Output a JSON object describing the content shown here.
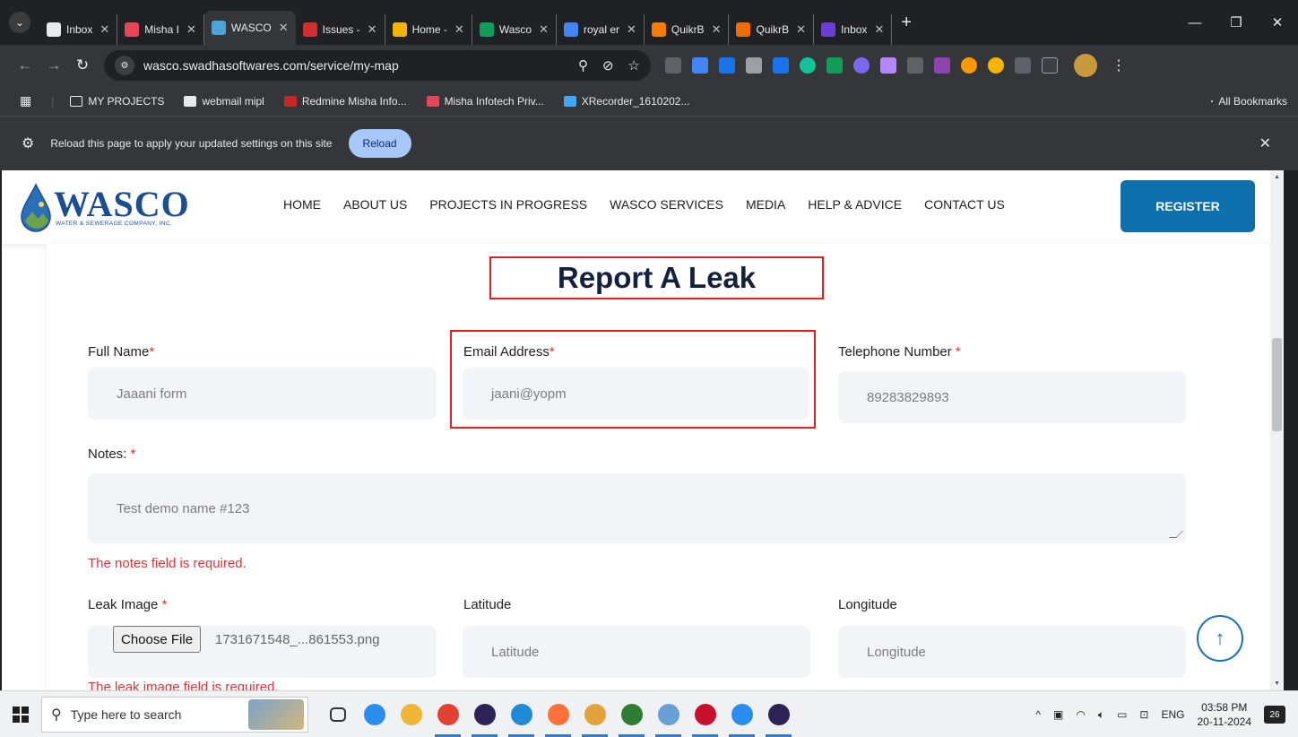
{
  "browser": {
    "tabs": [
      {
        "title": "Inbox",
        "color": "#e8eaed"
      },
      {
        "title": "Misha I",
        "color": "#e8455a"
      },
      {
        "title": "WASCO",
        "color": "#4ea3d8",
        "active": true
      },
      {
        "title": "Issues -",
        "color": "#d32f2f"
      },
      {
        "title": "Home -",
        "color": "#f4b400"
      },
      {
        "title": "Wasco",
        "color": "#0f9d58"
      },
      {
        "title": "royal er",
        "color": "#4285f4"
      },
      {
        "title": "QuikrB",
        "color": "#f57c00"
      },
      {
        "title": "QuikrB",
        "color": "#ef6c00"
      },
      {
        "title": "Inbox",
        "color": "#6a3fd4"
      }
    ],
    "new_tab": "+",
    "url": "wasco.swadhasoftwares.com/service/my-map",
    "bookmarks": [
      {
        "label": "MY PROJECTS",
        "icon": "folder-icon"
      },
      {
        "label": "webmail mipl",
        "icon": "mail-icon"
      },
      {
        "label": "Redmine Misha Info...",
        "icon": "redmine-icon"
      },
      {
        "label": "Misha Infotech Priv...",
        "icon": "misha-icon"
      },
      {
        "label": "XRecorder_1610202...",
        "icon": "recorder-icon"
      }
    ],
    "all_bookmarks": "All Bookmarks",
    "infobar_text": "Reload this page to apply your updated settings on this site",
    "reload_label": "Reload"
  },
  "site": {
    "logo_word": "WASCO",
    "logo_tagline": "WATER & SEWERAGE COMPANY, INC.",
    "menu": [
      "HOME",
      "ABOUT US",
      "PROJECTS IN PROGRESS",
      "WASCO SERVICES",
      "MEDIA",
      "HELP & ADVICE",
      "CONTACT US"
    ],
    "register_label": "REGISTER"
  },
  "form": {
    "title": "Report A Leak",
    "full_name": {
      "label": "Full Name",
      "required": "*",
      "value": "Jaaani form"
    },
    "email": {
      "label": "Email Address",
      "required": "*",
      "value": "jaani@yopm"
    },
    "telephone": {
      "label": "Telephone Number",
      "required": "*",
      "value": "89283829893"
    },
    "notes": {
      "label": "Notes:",
      "required": "*",
      "value": "Test demo name #123",
      "error": "The notes field is required."
    },
    "leak_image": {
      "label": "Leak Image",
      "required": "*",
      "button": "Choose File",
      "file": "1731671548_...861553.png",
      "error": "The leak image field is required."
    },
    "latitude": {
      "label": "Latitude",
      "placeholder": "Latitude"
    },
    "longitude": {
      "label": "Longitude",
      "placeholder": "Longitude"
    }
  },
  "taskbar": {
    "search_placeholder": "Type here to search",
    "apps": [
      {
        "name": "task-view-icon",
        "color": "#333333"
      },
      {
        "name": "skype-icon",
        "color": "#2a8ef0"
      },
      {
        "name": "file-explorer-icon",
        "color": "#f2b636"
      },
      {
        "name": "chrome-icon",
        "color": "#e34133"
      },
      {
        "name": "eclipse-icon",
        "color": "#2c2255"
      },
      {
        "name": "edge-icon",
        "color": "#1e8ad8"
      },
      {
        "name": "firefox-icon",
        "color": "#ff7139"
      },
      {
        "name": "chrome-canary-icon",
        "color": "#e2a33a"
      },
      {
        "name": "project-icon",
        "color": "#2f7d32"
      },
      {
        "name": "notepad-icon",
        "color": "#68a0d6"
      },
      {
        "name": "mcafee-icon",
        "color": "#c8102e"
      },
      {
        "name": "skype-icon",
        "color": "#2a8ef0"
      },
      {
        "name": "eclipse-icon",
        "color": "#2c2255"
      }
    ],
    "lang": "ENG",
    "time": "03:58 PM",
    "date": "20-11-2024",
    "notifications": "26"
  }
}
